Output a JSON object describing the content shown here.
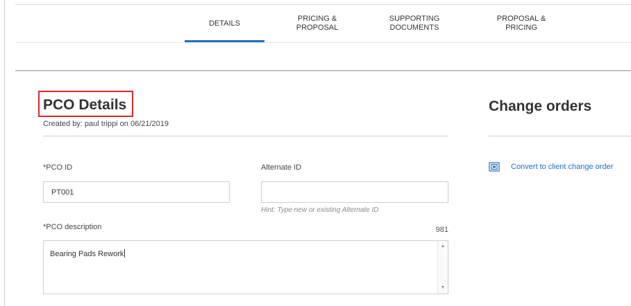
{
  "tabs": [
    {
      "label": "DETAILS",
      "active": true
    },
    {
      "label": "PRICING & PROPOSAL",
      "active": false
    },
    {
      "label": "SUPPORTING DOCUMENTS",
      "active": false
    },
    {
      "label": "PROPOSAL & PRICING",
      "active": false
    }
  ],
  "details": {
    "title": "PCO Details",
    "created": "Created by: paul trippi on 06/21/2019"
  },
  "form": {
    "pco_id_label": "*PCO ID",
    "pco_id_value": "PT001",
    "alternate_id_label": "Alternate ID",
    "alternate_id_value": "",
    "alternate_id_hint": "Hint: Type new or existing Alternate ID",
    "description_label": "*PCO description",
    "description_counter": "981",
    "description_value": "Bearing Pads Rework"
  },
  "change_orders": {
    "title": "Change orders",
    "action_label": "Convert to client change order",
    "action_icon": "convert-icon"
  },
  "colors": {
    "accent": "#1f6fc3",
    "highlight_border": "#d62828"
  }
}
